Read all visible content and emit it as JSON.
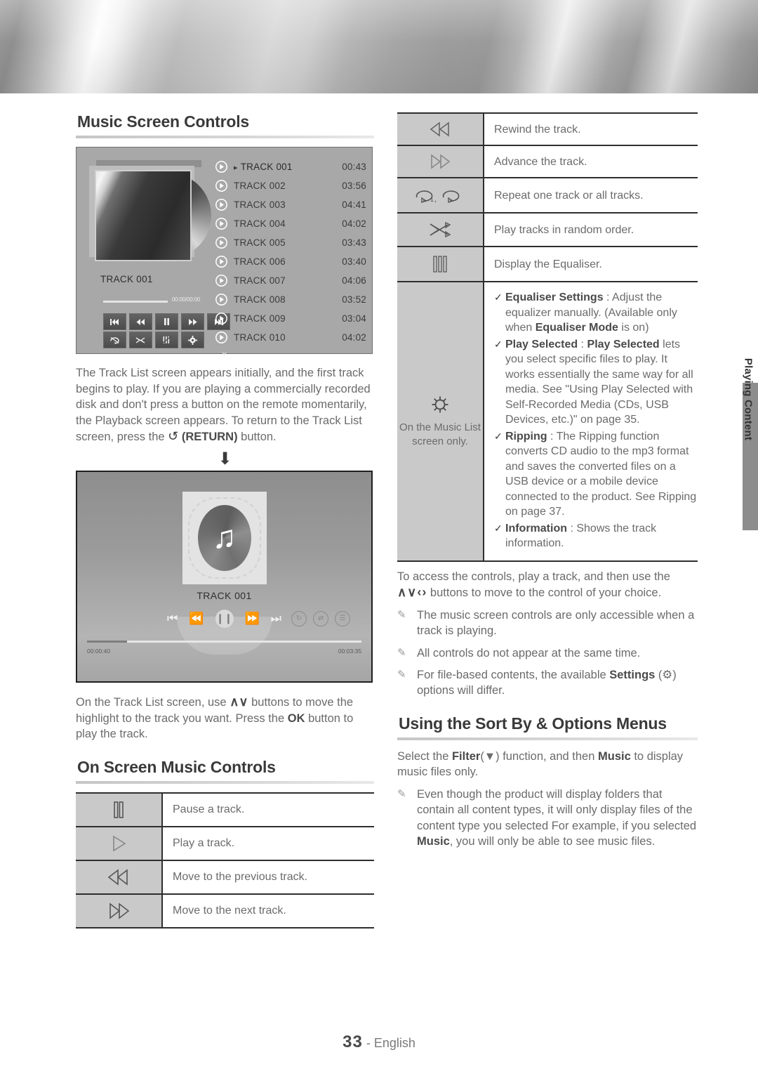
{
  "page": {
    "number": "33",
    "language": "- English"
  },
  "side_tab": {
    "label": "Playing Content"
  },
  "left": {
    "heading_music_screen": "Music Screen Controls",
    "track_screen": {
      "album_label": "TRACK 001",
      "timecode": "00:00/00:00",
      "tracks": [
        {
          "name": "TRACK 001",
          "time": "00:43"
        },
        {
          "name": "TRACK 002",
          "time": "03:56"
        },
        {
          "name": "TRACK 003",
          "time": "04:41"
        },
        {
          "name": "TRACK 004",
          "time": "04:02"
        },
        {
          "name": "TRACK 005",
          "time": "03:43"
        },
        {
          "name": "TRACK 006",
          "time": "03:40"
        },
        {
          "name": "TRACK 007",
          "time": "04:06"
        },
        {
          "name": "TRACK 008",
          "time": "03:52"
        },
        {
          "name": "TRACK 009",
          "time": "03:04"
        },
        {
          "name": "TRACK 010",
          "time": "04:02"
        }
      ]
    },
    "paragraph_1_a": "The Track List screen appears initially, and the first track begins to play. If you are playing a commercially recorded disk and don't press a button on the remote momentarily, the Playback screen appears. To return to the Track List screen, press the ",
    "paragraph_1_return": "(RETURN)",
    "paragraph_1_b": " button.",
    "playback_screen": {
      "title": "TRACK 001",
      "time_elapsed": "00:00:40",
      "time_total": "00:03:35"
    },
    "paragraph_2_a": "On the Track List screen, use ",
    "paragraph_2_keys": "∧∨",
    "paragraph_2_b": " buttons to move the highlight to the track you want. Press the ",
    "paragraph_2_ok": "OK",
    "paragraph_2_c": " button to play the track.",
    "heading_on_screen": "On Screen Music Controls",
    "onscreen_table": [
      {
        "icon": "pause-icon",
        "desc": "Pause a track."
      },
      {
        "icon": "play-icon",
        "desc": "Play a track."
      },
      {
        "icon": "previous-track-icon",
        "desc": "Move to the previous track."
      },
      {
        "icon": "next-track-icon",
        "desc": "Move to the next track."
      }
    ]
  },
  "right": {
    "controls_table": [
      {
        "icon": "rewind-icon",
        "desc": "Rewind the track."
      },
      {
        "icon": "fast-forward-icon",
        "desc": "Advance the track."
      },
      {
        "icon": "repeat-one-and-repeat-all-icon",
        "desc": "Repeat one track or all tracks."
      },
      {
        "icon": "shuffle-icon",
        "desc": "Play tracks in random order."
      },
      {
        "icon": "equaliser-icon",
        "desc": "Display the Equaliser."
      }
    ],
    "settings_row": {
      "icon": "gear-icon",
      "icon_caption": "On the Music List screen only.",
      "items": [
        {
          "mark": "✓",
          "bold_lead": "Equaliser Settings",
          "sep": " : ",
          "text_a": "Adjust the equalizer manually. (Available only when ",
          "bold_mid": "Equaliser Mode",
          "text_b": " is on)"
        },
        {
          "mark": "✓",
          "bold_lead": "Play Selected",
          "sep": " : ",
          "bold_mid": "Play Selected",
          "text_b": " lets you select specific files to play. It works essentially the same way for all media. See \"Using Play Selected with Self-Recorded Media (CDs, USB Devices, etc.)\" on page 35."
        },
        {
          "mark": "✓",
          "bold_lead": "Ripping",
          "sep": " : ",
          "text_a": "The Ripping function converts CD audio to the mp3 format and saves the converted files on a USB device or a mobile device connected to the product. See Ripping on page 37."
        },
        {
          "mark": "✓",
          "bold_lead": "Information",
          "sep": " : ",
          "text_a": "Shows the track information."
        }
      ]
    },
    "paragraph_access_a": "To access the controls, play a track, and then use the ",
    "paragraph_access_keys": "∧∨‹›",
    "paragraph_access_b": " buttons to move to the control of your choice.",
    "notes": [
      {
        "text_a": "The music screen controls are only accessible when a track is playing."
      },
      {
        "text_a": "All controls do not appear at the same time."
      },
      {
        "text_a": "For file-based contents, the available ",
        "bold": "Settings",
        "text_b": " (⚙) options will differ."
      }
    ],
    "heading_sort_by": "Using the Sort By & Options Menus",
    "paragraph_filter_a": "Select the ",
    "paragraph_filter_bold": "Filter",
    "paragraph_filter_mid": "(▼) function, and then ",
    "paragraph_filter_bold2": "Music",
    "paragraph_filter_b": " to display music files only.",
    "note_sort": {
      "text_a": "Even though the product will display folders that contain all content types, it will only display files of the content type you selected For example, if you selected ",
      "bold": "Music",
      "text_b": ", you will only be able to see music files."
    }
  }
}
